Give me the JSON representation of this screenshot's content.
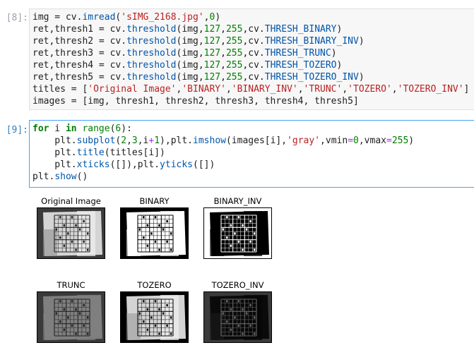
{
  "cells": [
    {
      "prompt": "[8]:",
      "lines": [
        [
          [
            "t",
            "img = cv."
          ],
          [
            "f",
            "imread"
          ],
          [
            "t",
            "("
          ],
          [
            "s",
            "'sIMG_2168.jpg'"
          ],
          [
            "t",
            ","
          ],
          [
            "n",
            "0"
          ],
          [
            "t",
            ")"
          ]
        ],
        [
          [
            "t",
            "ret,thresh1 = cv."
          ],
          [
            "f",
            "threshold"
          ],
          [
            "t",
            "(img,"
          ],
          [
            "n",
            "127"
          ],
          [
            "t",
            ","
          ],
          [
            "n",
            "255"
          ],
          [
            "t",
            ",cv."
          ],
          [
            "at",
            "THRESH_BINARY"
          ],
          [
            "t",
            ")"
          ]
        ],
        [
          [
            "t",
            "ret,thresh2 = cv."
          ],
          [
            "f",
            "threshold"
          ],
          [
            "t",
            "(img,"
          ],
          [
            "n",
            "127"
          ],
          [
            "t",
            ","
          ],
          [
            "n",
            "255"
          ],
          [
            "t",
            ",cv."
          ],
          [
            "at",
            "THRESH_BINARY_INV"
          ],
          [
            "t",
            ")"
          ]
        ],
        [
          [
            "t",
            "ret,thresh3 = cv."
          ],
          [
            "f",
            "threshold"
          ],
          [
            "t",
            "(img,"
          ],
          [
            "n",
            "127"
          ],
          [
            "t",
            ","
          ],
          [
            "n",
            "255"
          ],
          [
            "t",
            ",cv."
          ],
          [
            "at",
            "THRESH_TRUNC"
          ],
          [
            "t",
            ")"
          ]
        ],
        [
          [
            "t",
            "ret,thresh4 = cv."
          ],
          [
            "f",
            "threshold"
          ],
          [
            "t",
            "(img,"
          ],
          [
            "n",
            "127"
          ],
          [
            "t",
            ","
          ],
          [
            "n",
            "255"
          ],
          [
            "t",
            ",cv."
          ],
          [
            "at",
            "THRESH_TOZERO"
          ],
          [
            "t",
            ")"
          ]
        ],
        [
          [
            "t",
            "ret,thresh5 = cv."
          ],
          [
            "f",
            "threshold"
          ],
          [
            "t",
            "(img,"
          ],
          [
            "n",
            "127"
          ],
          [
            "t",
            ","
          ],
          [
            "n",
            "255"
          ],
          [
            "t",
            ",cv."
          ],
          [
            "at",
            "THRESH_TOZERO_INV"
          ],
          [
            "t",
            ")"
          ]
        ],
        [
          [
            "t",
            "titles = ["
          ],
          [
            "s",
            "'Original Image'"
          ],
          [
            "t",
            ","
          ],
          [
            "s",
            "'BINARY'"
          ],
          [
            "t",
            ","
          ],
          [
            "s",
            "'BINARY_INV'"
          ],
          [
            "t",
            ","
          ],
          [
            "s",
            "'TRUNC'"
          ],
          [
            "t",
            ","
          ],
          [
            "s",
            "'TOZERO'"
          ],
          [
            "t",
            ","
          ],
          [
            "s",
            "'TOZERO_INV'"
          ],
          [
            "t",
            "]"
          ]
        ],
        [
          [
            "t",
            "images = [img, thresh1, thresh2, thresh3, thresh4, thresh5]"
          ]
        ]
      ]
    },
    {
      "prompt": "[9]:",
      "lines": [
        [
          [
            "k",
            "for"
          ],
          [
            "t",
            " i "
          ],
          [
            "k",
            "in"
          ],
          [
            "t",
            " "
          ],
          [
            "bi",
            "range"
          ],
          [
            "t",
            "("
          ],
          [
            "n",
            "6"
          ],
          [
            "t",
            "):"
          ]
        ],
        [
          [
            "t",
            "    plt."
          ],
          [
            "f",
            "subplot"
          ],
          [
            "t",
            "("
          ],
          [
            "n",
            "2"
          ],
          [
            "t",
            ","
          ],
          [
            "n",
            "3"
          ],
          [
            "t",
            ",i"
          ],
          [
            "o",
            "+"
          ],
          [
            "n",
            "1"
          ],
          [
            "t",
            "),plt."
          ],
          [
            "f",
            "imshow"
          ],
          [
            "t",
            "(images[i],"
          ],
          [
            "s",
            "'gray'"
          ],
          [
            "t",
            ",vmin"
          ],
          [
            "o",
            "="
          ],
          [
            "n",
            "0"
          ],
          [
            "t",
            ",vmax"
          ],
          [
            "o",
            "="
          ],
          [
            "n",
            "255"
          ],
          [
            "t",
            ")"
          ]
        ],
        [
          [
            "t",
            "    plt."
          ],
          [
            "f",
            "title"
          ],
          [
            "t",
            "(titles[i])"
          ]
        ],
        [
          [
            "t",
            "    plt."
          ],
          [
            "f",
            "xticks"
          ],
          [
            "t",
            "([]),plt."
          ],
          [
            "f",
            "yticks"
          ],
          [
            "t",
            "([])"
          ]
        ],
        [
          [
            "t",
            "plt."
          ],
          [
            "f",
            "show"
          ],
          [
            "t",
            "()"
          ]
        ]
      ]
    }
  ],
  "output_titles": [
    "Original Image",
    "BINARY",
    "BINARY_INV",
    "TRUNC",
    "TOZERO",
    "TOZERO_INV"
  ],
  "thumb_styles": [
    {
      "bg": "#3a3a3a",
      "paper": "#d4d4d4",
      "grid": "#222",
      "shade": "#8f8f8f",
      "glow": "#f0f0f0"
    },
    {
      "bg": "#000000",
      "paper": "#ffffff",
      "grid": "#000",
      "shade": "#ffffff",
      "glow": "#ffffff"
    },
    {
      "bg": "#ffffff",
      "paper": "#000000",
      "grid": "#fff",
      "shade": "#000000",
      "glow": "#000000"
    },
    {
      "bg": "#3a3a3a",
      "paper": "#7f7f7f",
      "grid": "#222",
      "shade": "#7f7f7f",
      "glow": "#7f7f7f"
    },
    {
      "bg": "#000000",
      "paper": "#d4d4d4",
      "grid": "#111",
      "shade": "#9a9a9a",
      "glow": "#f0f0f0"
    },
    {
      "bg": "#3a3a3a",
      "paper": "#0a0a0a",
      "grid": "#666",
      "shade": "#1a1a1a",
      "glow": "#050505"
    }
  ]
}
